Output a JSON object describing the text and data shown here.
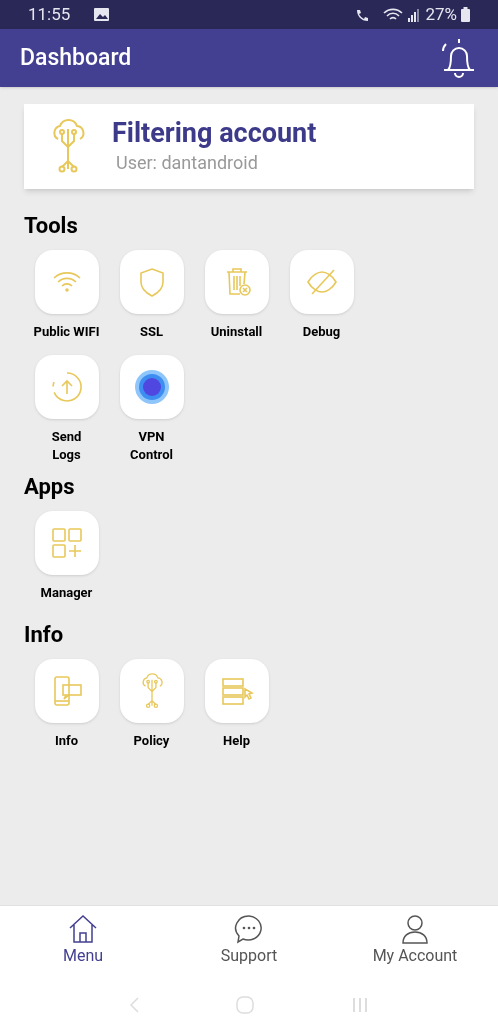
{
  "status_bar": {
    "time": "11:55",
    "battery": "27%"
  },
  "app_bar": {
    "title": "Dashboard"
  },
  "account_card": {
    "title": "Filtering account",
    "subtitle": "User: dantandroid"
  },
  "sections": [
    {
      "title": "Tools",
      "items": [
        {
          "label": "Public WIFI"
        },
        {
          "label": "SSL"
        },
        {
          "label": "Uninstall"
        },
        {
          "label": "Debug"
        },
        {
          "label": "Send\nLogs"
        },
        {
          "label": "VPN\nControl"
        }
      ]
    },
    {
      "title": "Apps",
      "items": [
        {
          "label": "Manager"
        }
      ]
    },
    {
      "title": "Info",
      "items": [
        {
          "label": "Info"
        },
        {
          "label": "Policy"
        },
        {
          "label": "Help"
        }
      ]
    }
  ],
  "bottom_nav": [
    {
      "label": "Menu",
      "selected": true
    },
    {
      "label": "Support",
      "selected": false
    },
    {
      "label": "My Account",
      "selected": false
    }
  ]
}
